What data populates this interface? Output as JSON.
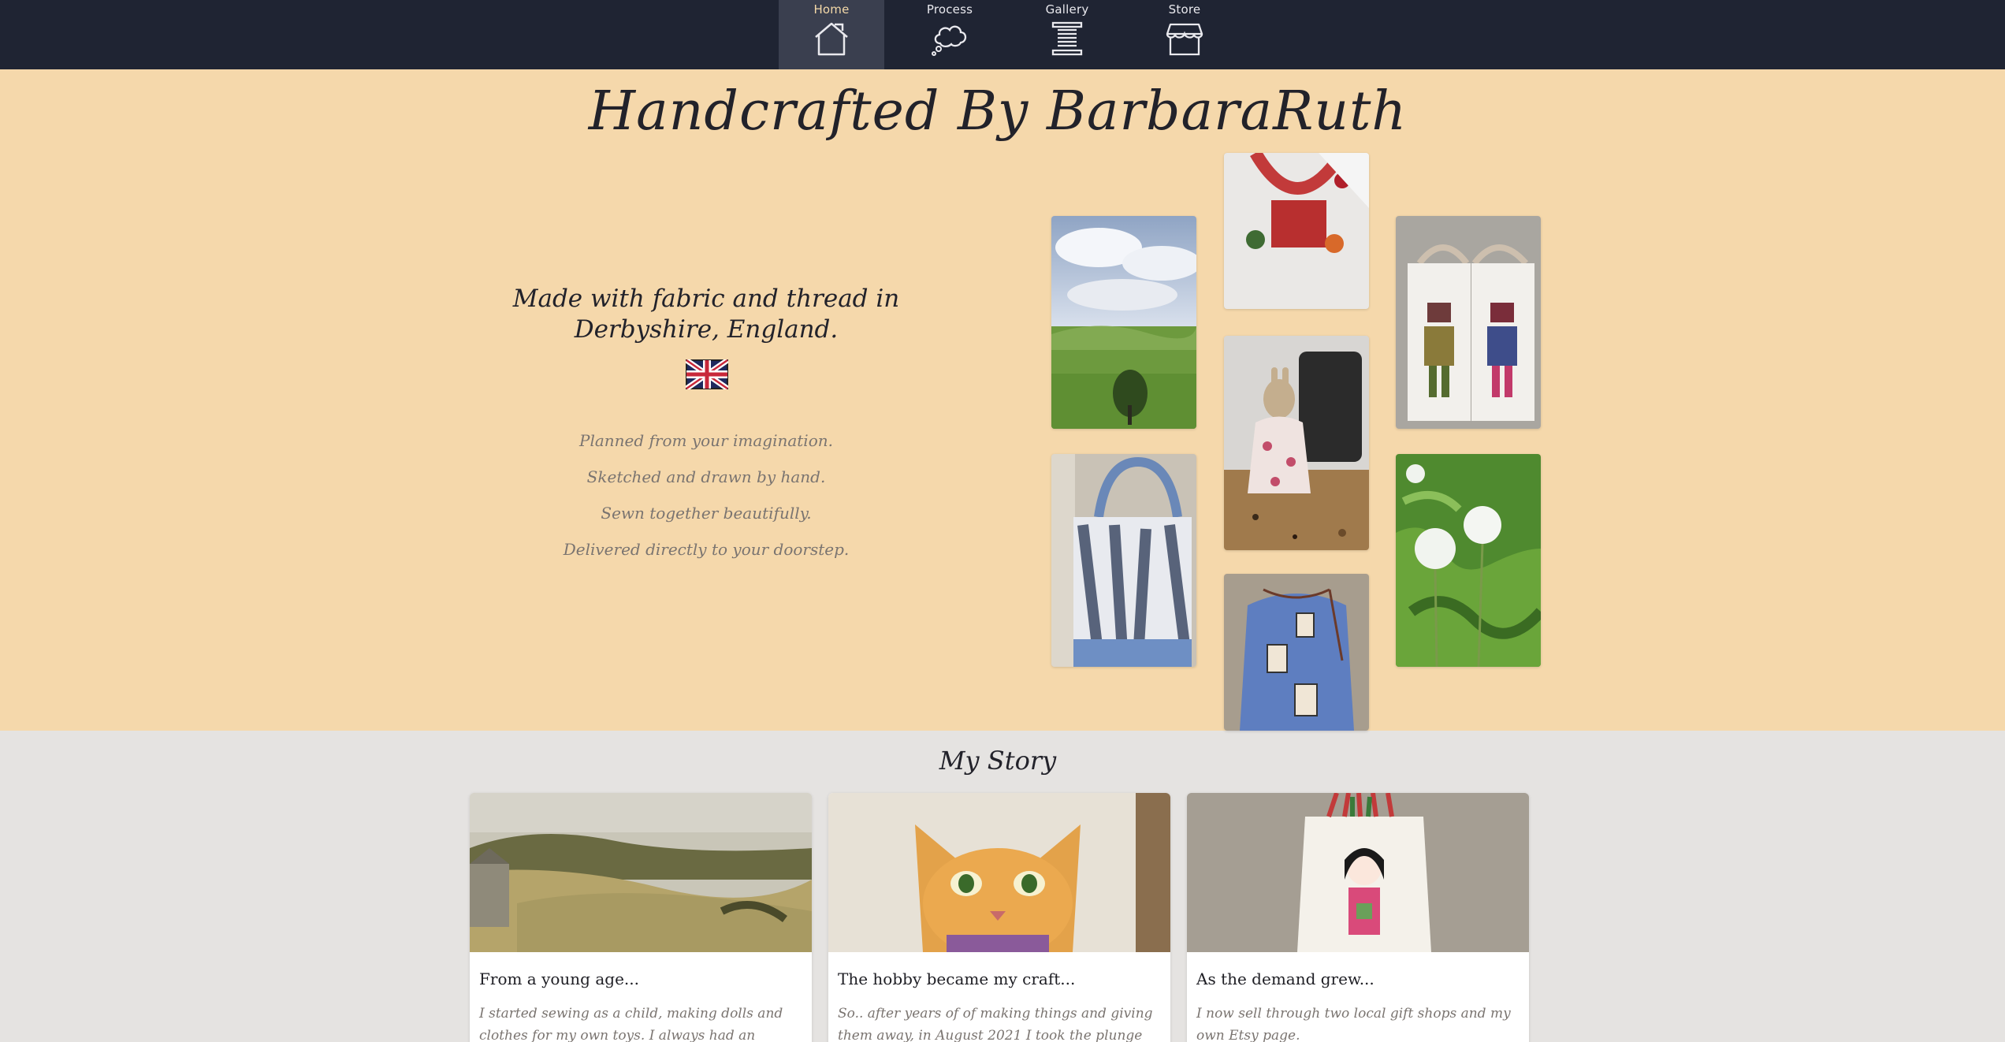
{
  "nav": {
    "items": [
      {
        "label": "Home",
        "icon": "home-icon"
      },
      {
        "label": "Process",
        "icon": "thought-cloud-icon"
      },
      {
        "label": "Gallery",
        "icon": "thread-spool-icon"
      },
      {
        "label": "Store",
        "icon": "storefront-icon"
      }
    ],
    "active": "Home"
  },
  "hero": {
    "title": "Handcrafted By BarbaraRuth",
    "tagline": "Made with fabric and thread in Derbyshire, England.",
    "flag_icon": "union-jack-flag-icon",
    "steps": [
      "Planned from your imagination.",
      "Sketched and drawn by hand.",
      "Sewn together beautifully.",
      "Delivered directly to your doorstep."
    ]
  },
  "gallery_tiles": [
    {
      "name": "tile-countryside-photo"
    },
    {
      "name": "tile-tote-bag-photo"
    },
    {
      "name": "tile-appliqued-bag-photo"
    },
    {
      "name": "tile-rabbit-doll-photo"
    },
    {
      "name": "tile-drawstring-bag-photo"
    },
    {
      "name": "tile-robot-bags-photo"
    },
    {
      "name": "tile-dandelion-photo"
    }
  ],
  "story": {
    "heading": "My Story",
    "cards": [
      {
        "title": "From a young age...",
        "text": "I started sewing as a child, making dolls and clothes for my own toys. I always had an"
      },
      {
        "title": "The hobby became my craft...",
        "text": "So.. after years of of making things and giving them away, in August 2021 I took the plunge"
      },
      {
        "title": "As the demand grew...",
        "text": "I now sell through two local gift shops and my own Etsy page."
      }
    ]
  },
  "colors": {
    "nav_bg": "#1f2433",
    "hero_bg": "#f5d8ab",
    "story_bg": "#e5e3e1",
    "active_label": "#f4d9a8"
  }
}
